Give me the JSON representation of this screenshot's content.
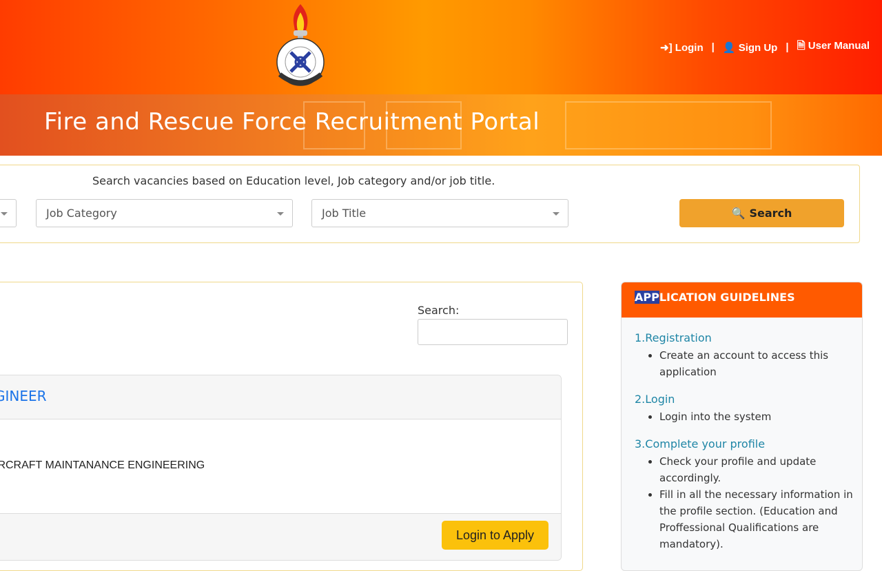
{
  "header": {
    "logo_text": "JESHI LA ZIMAMOTO NA UOKOAJI TANZANIA KUOKOA MAISHA NA MALI",
    "nav": [
      {
        "label": "Login",
        "icon": "sign-in-icon"
      },
      {
        "label": "Sign Up",
        "icon": "user-icon"
      },
      {
        "label": "User Manual",
        "icon": "file-pdf-icon"
      }
    ],
    "separator": "|"
  },
  "banner": {
    "title": "Fire and Rescue Force Recruitment Portal"
  },
  "search": {
    "hint": "Search vacancies based on Education level, Job category and/or job title.",
    "job_category": "Job Category",
    "job_title": "Job Title",
    "button": "Search"
  },
  "vacancies": {
    "search_label": "Search:",
    "search_value": "",
    "items": [
      {
        "title": "GINEER",
        "description": "IRCRAFT MAINTANANCE ENGINEERING",
        "apply": "Login to Apply"
      }
    ]
  },
  "guidelines": {
    "title_highlight": "APP",
    "title_rest": "LICATION GUIDELINES",
    "sections": [
      {
        "heading": "1.Registration",
        "items": [
          "Create an account to access this application"
        ]
      },
      {
        "heading": "2.Login",
        "items": [
          "Login into the system"
        ]
      },
      {
        "heading": "3.Complete your profile",
        "items": [
          "Check your profile and update accordingly.",
          "Fill in all the necessary information in the profile section. (Education and Proffessional Qualifications are mandatory)."
        ]
      }
    ]
  },
  "colors": {
    "header_orange": "#ff9a00",
    "header_red": "#ff3c00",
    "search_button": "#f0a22c",
    "apply_button": "#fbc10b",
    "guide_header": "#ff5a00",
    "link_blue": "#1a73e8"
  }
}
